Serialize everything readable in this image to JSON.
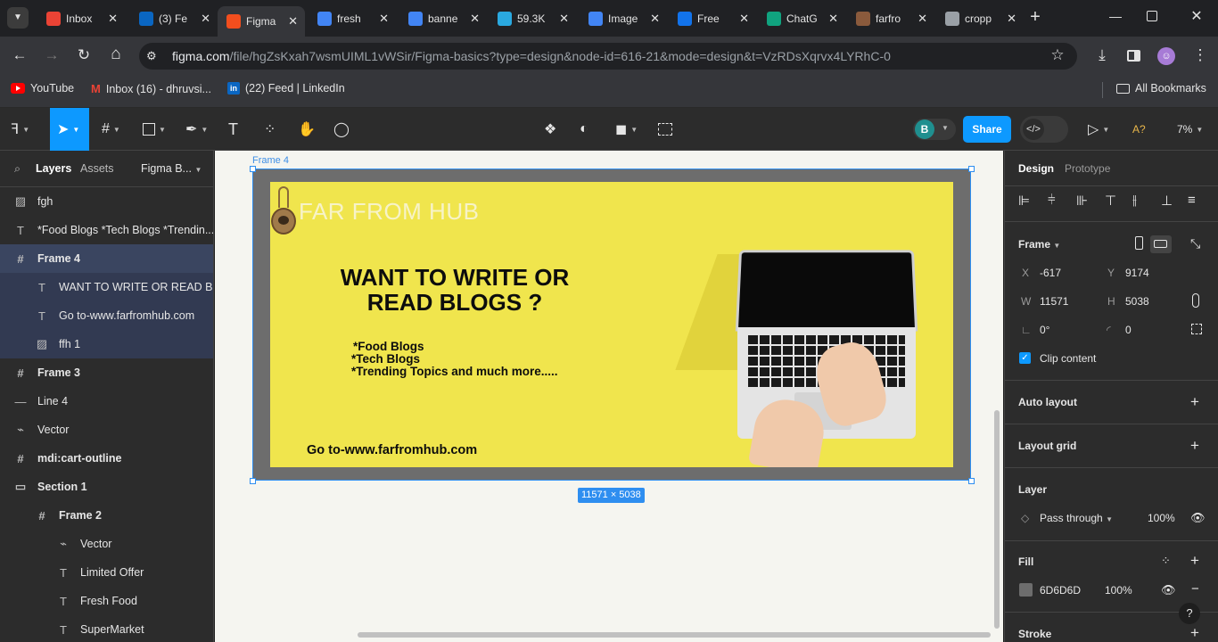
{
  "browser": {
    "tabs": [
      {
        "title": "Inbox",
        "icon": "gmail-icon",
        "color": "#ea4335"
      },
      {
        "title": "(3) Fe",
        "icon": "linkedin-icon",
        "color": "#0a66c2"
      },
      {
        "title": "Figma",
        "icon": "figma-icon",
        "color": "#f24e1e"
      },
      {
        "title": "fresh",
        "icon": "google-icon",
        "color": "#4285f4"
      },
      {
        "title": "banne",
        "icon": "google-icon",
        "color": "#4285f4"
      },
      {
        "title": "59.3K",
        "icon": "play-arrow-icon",
        "color": "#2aa9e0"
      },
      {
        "title": "Image",
        "icon": "google-icon",
        "color": "#4285f4"
      },
      {
        "title": "Free",
        "icon": "freepik-icon",
        "color": "#1273eb"
      },
      {
        "title": "ChatG",
        "icon": "chatgpt-icon",
        "color": "#10a37f"
      },
      {
        "title": "farfro",
        "icon": "lamp-icon",
        "color": "#8a5a3c"
      },
      {
        "title": "cropp",
        "icon": "globe-icon",
        "color": "#9aa0a6"
      }
    ],
    "url_host": "figma.com",
    "url_path": "/file/hgZsKxah7wsmUIML1vWSir/Figma-basics?type=design&node-id=616-21&mode=design&t=VzRDsXqrvx4LYRhC-0",
    "bookmarks": [
      {
        "label": "YouTube",
        "icon": "youtube-icon"
      },
      {
        "label": "Inbox (16) - dhruvsi...",
        "icon": "gmail-icon"
      },
      {
        "label": "(22) Feed | LinkedIn",
        "icon": "linkedin-icon"
      }
    ],
    "all_bookmarks": "All Bookmarks"
  },
  "toolbar": {
    "avatar_letter": "B",
    "share": "Share",
    "zoom": "7%",
    "autofix": "A?"
  },
  "left_panel": {
    "tabs": [
      "Layers",
      "Assets"
    ],
    "page_name": "Figma B...",
    "layers": [
      {
        "name": "fgh",
        "icon": "image-icon"
      },
      {
        "name": "*Food Blogs *Tech Blogs *Trendin...",
        "icon": "text-icon"
      },
      {
        "name": "Frame 4",
        "icon": "frame-icon"
      },
      {
        "name": "WANT TO WRITE OR READ BL...",
        "icon": "text-icon"
      },
      {
        "name": "Go to-www.farfromhub.com",
        "icon": "text-icon"
      },
      {
        "name": "ffh 1",
        "icon": "image-icon"
      },
      {
        "name": "Frame 3",
        "icon": "frame-icon"
      },
      {
        "name": "Line 4",
        "icon": "line-icon"
      },
      {
        "name": "Vector",
        "icon": "vector-icon"
      },
      {
        "name": "mdi:cart-outline",
        "icon": "frame-icon"
      },
      {
        "name": "Section 1",
        "icon": "section-icon"
      },
      {
        "name": "Frame 2",
        "icon": "frame-icon"
      },
      {
        "name": "Vector",
        "icon": "vector-icon"
      },
      {
        "name": "Limited Offer",
        "icon": "text-icon"
      },
      {
        "name": "Fresh Food",
        "icon": "text-icon"
      },
      {
        "name": "SuperMarket",
        "icon": "text-icon"
      }
    ]
  },
  "canvas": {
    "frame_label": "Frame 4",
    "size_badge": "11571 × 5038",
    "banner": {
      "brand": "FAR FROM HUB",
      "headline_line1": "WANT TO WRITE OR",
      "headline_line2": "READ BLOGS ?",
      "list": [
        "*Food Blogs",
        "*Tech Blogs",
        "*Trending Topics and much more....."
      ],
      "cta": "Go to-www.farfromhub.com",
      "bg_color": "#f0e54d"
    }
  },
  "right_panel": {
    "tabs": [
      "Design",
      "Prototype"
    ],
    "frame_section": "Frame",
    "x_label": "X",
    "x": "-617",
    "y_label": "Y",
    "y": "9174",
    "w_label": "W",
    "w": "11571",
    "h_label": "H",
    "h": "5038",
    "rotation": "0°",
    "radius": "0",
    "clip_content": "Clip content",
    "auto_layout": "Auto layout",
    "layout_grid": "Layout grid",
    "layer_section": "Layer",
    "blend": "Pass through",
    "opacity": "100%",
    "fill_section": "Fill",
    "fill_hex": "6D6D6D",
    "fill_opacity": "100%",
    "fill_color": "#6d6d6d",
    "stroke_section": "Stroke",
    "help": "?"
  }
}
